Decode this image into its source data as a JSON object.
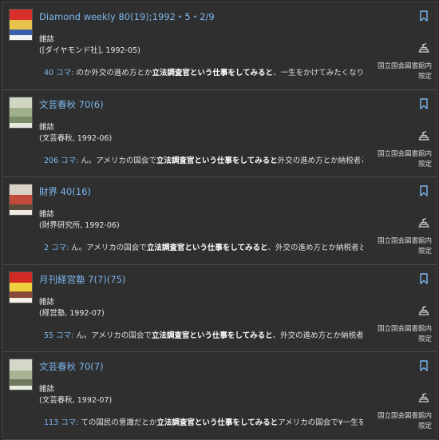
{
  "colors": {
    "link": "#7db7ee",
    "background": "#2f2f2f",
    "divider": "#4a4a4a"
  },
  "results": [
    {
      "title": "Diamond weekly 80(19);1992・5・2/9",
      "type": "雑誌",
      "publisher": "([ダイヤモンド社], 1992-05)",
      "koma": "40 コマ:",
      "snippet_pre": " のか外交の進め方とか",
      "snippet_hl": "立法調査官という仕事をしてみると",
      "snippet_post": "、一生をかけてみたくなりました。アメリ…",
      "access": "国立国会図書館内限定",
      "thumb_colors": [
        "#d9302b",
        "#e8c24a",
        "#3a5da8",
        "#f2f2f2"
      ]
    },
    {
      "title": "文芸春秋 70(6)",
      "type": "雑誌",
      "publisher": "(文芸春秋, 1992-06)",
      "koma": "206 コマ:",
      "snippet_pre": " ん。アメリカの国会で",
      "snippet_hl": "立法調査官という仕事をしてみると",
      "snippet_post": "外交の進め方とか納税者としての国民の…",
      "access": "国立国会図書館内限定",
      "thumb_colors": [
        "#cfd6c4",
        "#9fb08a",
        "#7d8c6a",
        "#e4e8dc"
      ]
    },
    {
      "title": "財界 40(16)",
      "type": "雑誌",
      "publisher": "(財界研究所, 1992-06)",
      "koma": "2 コマ:",
      "snippet_pre": " ん。アメリカの国会で",
      "snippet_hl": "立法調査官という仕事をしてみると",
      "snippet_post": "、外交の進め方とか納税者としての",
      "access": "国立国会図書館内限定",
      "thumb_colors": [
        "#d8d2c4",
        "#c24a3a",
        "#5a4a3a",
        "#f0ece4"
      ]
    },
    {
      "title": "月刊経営塾 7(7)(75)",
      "type": "雑誌",
      "publisher": "(経営塾, 1992-07)",
      "koma": "55 コマ:",
      "snippet_pre": " ん。アメリカの国会で",
      "snippet_hl": "立法調査官という仕事をしてみると",
      "snippet_post": "、外交の進め方とか納税者としての国民の…",
      "access": "国立国会図書館内限定",
      "thumb_colors": [
        "#d42a24",
        "#f0d040",
        "#8a4a3a",
        "#f4f0e6"
      ]
    },
    {
      "title": "文芸春秋 70(7)",
      "type": "雑誌",
      "publisher": "(文芸春秋, 1992-07)",
      "koma": "113 コマ:",
      "snippet_pre": " ての国民の意識だとか",
      "snippet_hl": "立法調査官という仕事をしてみると",
      "snippet_post": "アメリカの国会で¥一生をかけてみたく…",
      "access": "国立国会図書館内限定",
      "thumb_colors": [
        "#d4d8c8",
        "#a8b494",
        "#6e7a5e",
        "#e8ebe0"
      ]
    }
  ]
}
